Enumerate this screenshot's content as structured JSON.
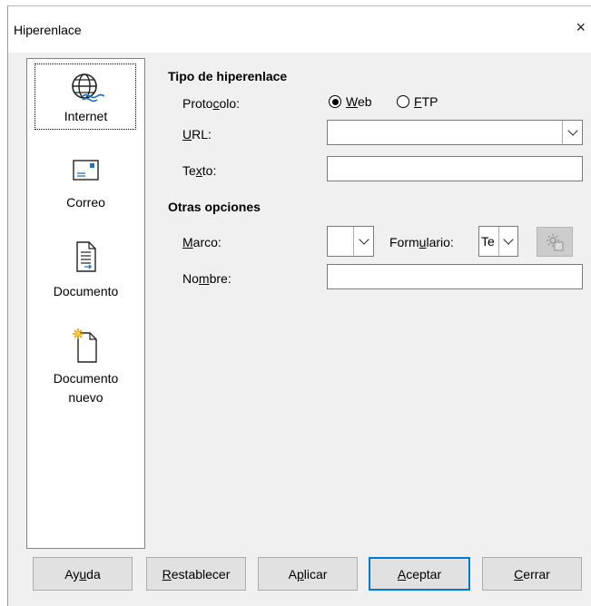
{
  "window": {
    "title": "Hiperenlace",
    "close_glyph": "×"
  },
  "sidebar": {
    "items": [
      {
        "label": "Internet",
        "icon": "globe-icon",
        "selected": true
      },
      {
        "label": "Correo",
        "icon": "envelope-icon"
      },
      {
        "label": "Documento",
        "icon": "document-icon"
      },
      {
        "label": "Documento",
        "label2": "nuevo",
        "icon": "new-document-icon"
      }
    ]
  },
  "hyperlink_type": {
    "heading": "Tipo de hiperenlace",
    "protocol_label": {
      "pre": "Proto",
      "key": "c",
      "post": "olo:"
    },
    "radio_web": {
      "pre": "",
      "key": "W",
      "post": "eb",
      "checked": true
    },
    "radio_ftp": {
      "pre": "",
      "key": "F",
      "post": "TP",
      "checked": false
    },
    "url_label": {
      "pre": "",
      "key": "U",
      "post": "RL:"
    },
    "url_value": "",
    "text_label": {
      "pre": "Te",
      "key": "x",
      "post": "to:"
    },
    "text_value": ""
  },
  "other_options": {
    "heading": "Otras opciones",
    "frame_label": {
      "pre": "",
      "key": "M",
      "post": "arco:"
    },
    "frame_value": "",
    "form_label": {
      "pre": "Form",
      "key": "u",
      "post": "lario:"
    },
    "form_value": "Te",
    "name_label": {
      "pre": "No",
      "key": "m",
      "post": "bre:"
    },
    "name_value": "",
    "events_icon": "gear-icon"
  },
  "buttons": {
    "help": {
      "pre": "Ay",
      "key": "u",
      "post": "da"
    },
    "reset": {
      "pre": "",
      "key": "R",
      "post": "establecer"
    },
    "apply": {
      "pre": "A",
      "key": "p",
      "post": "licar"
    },
    "ok": {
      "pre": "",
      "key": "A",
      "post": "ceptar"
    },
    "close": {
      "pre": "",
      "key": "C",
      "post": "errar"
    }
  },
  "colors": {
    "accent": "#0078d7",
    "dialog_bg": "#f0f0f0",
    "button_bg": "#e1e1e1"
  }
}
